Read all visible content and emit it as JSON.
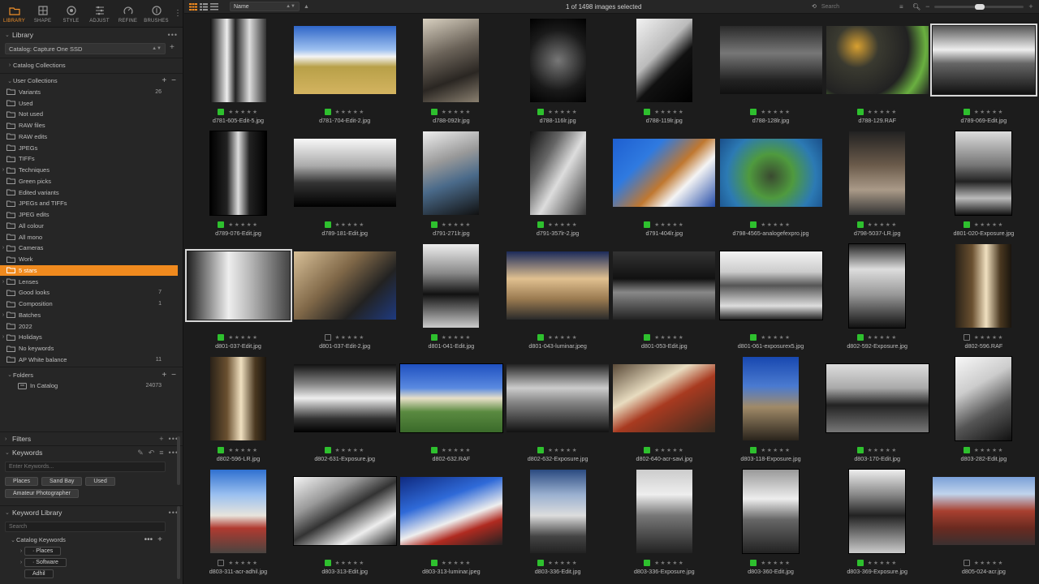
{
  "tool_tabs": [
    {
      "label": "LIBRARY",
      "icon": "library-icon",
      "active": true
    },
    {
      "label": "SHAPE",
      "icon": "shape-icon",
      "active": false
    },
    {
      "label": "STYLE",
      "icon": "style-icon",
      "active": false
    },
    {
      "label": "ADJUST",
      "icon": "adjust-icon",
      "active": false
    },
    {
      "label": "REFINE",
      "icon": "refine-icon",
      "active": false
    },
    {
      "label": "BRUSHES",
      "icon": "brushes-icon",
      "active": false
    }
  ],
  "library": {
    "title": "Library",
    "catalog": "Catalog: Capture One SSD",
    "catalog_collections": "Catalog Collections",
    "user_collections": "User Collections",
    "items": [
      {
        "label": "Variants",
        "count": "26",
        "expand": ""
      },
      {
        "label": "Used",
        "count": "",
        "expand": ""
      },
      {
        "label": "Not used",
        "count": "",
        "expand": ""
      },
      {
        "label": "RAW files",
        "count": "",
        "expand": ""
      },
      {
        "label": "RAW edits",
        "count": "",
        "expand": ""
      },
      {
        "label": "JPEGs",
        "count": "",
        "expand": ""
      },
      {
        "label": "TIFFs",
        "count": "",
        "expand": ""
      },
      {
        "label": "Techniques",
        "count": "",
        "expand": "›"
      },
      {
        "label": "Green picks",
        "count": "",
        "expand": ""
      },
      {
        "label": "Edited variants",
        "count": "",
        "expand": ""
      },
      {
        "label": "JPEGs and TIFFs",
        "count": "",
        "expand": ""
      },
      {
        "label": "JPEG edits",
        "count": "",
        "expand": ""
      },
      {
        "label": "All colour",
        "count": "",
        "expand": ""
      },
      {
        "label": "All mono",
        "count": "",
        "expand": ""
      },
      {
        "label": "Cameras",
        "count": "",
        "expand": "›"
      },
      {
        "label": "Work",
        "count": "",
        "expand": ""
      },
      {
        "label": "5 stars",
        "count": "",
        "expand": "",
        "selected": true
      },
      {
        "label": "Lenses",
        "count": "",
        "expand": "›"
      },
      {
        "label": "Good looks",
        "count": "7",
        "expand": ""
      },
      {
        "label": "Composition",
        "count": "1",
        "expand": ""
      },
      {
        "label": "Batches",
        "count": "",
        "expand": "›"
      },
      {
        "label": "2022",
        "count": "",
        "expand": ""
      },
      {
        "label": "Holidays",
        "count": "",
        "expand": "›"
      },
      {
        "label": "No keywords",
        "count": "",
        "expand": ""
      },
      {
        "label": "AP White balance",
        "count": "11",
        "expand": ""
      }
    ],
    "folders": "Folders",
    "in_catalog": "In Catalog",
    "in_catalog_count": "24073"
  },
  "filters": {
    "title": "Filters"
  },
  "keywords": {
    "title": "Keywords",
    "placeholder": "Enter Keywords...",
    "chips": [
      "Places",
      "Sand Bay",
      "Used",
      "Amateur Photographer"
    ]
  },
  "keyword_library": {
    "title": "Keyword Library",
    "search_placeholder": "Search",
    "catalog_keywords": "Catalog Keywords",
    "items": [
      "Places",
      "Software",
      "Adhil"
    ]
  },
  "topbar": {
    "sort": "Name",
    "selection": "1 of 1498 images selected",
    "search_placeholder": "Search"
  },
  "images": [
    {
      "name": "d781-605-Edit-5.jpg",
      "tag": "green",
      "orient": "p",
      "style": "mono-arch",
      "selected": false
    },
    {
      "name": "d781-704-Edit-2.jpg",
      "tag": "green",
      "orient": "l",
      "style": "field",
      "selected": false
    },
    {
      "name": "d788-092lr.jpg",
      "tag": "green",
      "orient": "p",
      "style": "sepia-cafe",
      "selected": false
    },
    {
      "name": "d788-116lr.jpg",
      "tag": "green",
      "orient": "p",
      "style": "bikes",
      "selected": false
    },
    {
      "name": "d788-119lr.jpg",
      "tag": "green",
      "orient": "p",
      "style": "lamp",
      "selected": false
    },
    {
      "name": "d788-128lr.jpg",
      "tag": "green",
      "orient": "l",
      "style": "house-dark",
      "selected": false
    },
    {
      "name": "d788-129.RAF",
      "tag": "green",
      "orient": "l",
      "style": "leaves",
      "selected": false
    },
    {
      "name": "d789-069-Edit.jpg",
      "tag": "green",
      "orient": "l",
      "style": "church",
      "selected": true
    },
    {
      "name": "d789-076-Edit.jpg",
      "tag": "green",
      "orient": "p",
      "style": "corridor",
      "selected": false,
      "frame": true
    },
    {
      "name": "d789-181-Edit.jpg",
      "tag": "green",
      "orient": "l",
      "style": "tor",
      "selected": false
    },
    {
      "name": "d791-271lr.jpg",
      "tag": "green",
      "orient": "p",
      "style": "modern",
      "selected": false
    },
    {
      "name": "d791-357lr-2.jpg",
      "tag": "green",
      "orient": "p",
      "style": "building-up",
      "selected": false
    },
    {
      "name": "d791-404lr.jpg",
      "tag": "green",
      "orient": "l",
      "style": "autumn",
      "selected": false
    },
    {
      "name": "d798-4565-analogefexpro.jpg",
      "tag": "green",
      "orient": "l",
      "style": "tree-up",
      "selected": false
    },
    {
      "name": "d798-5037-LR.jpg",
      "tag": "green",
      "orient": "p",
      "style": "towers",
      "selected": false
    },
    {
      "name": "d801-020-Exposure.jpg",
      "tag": "green",
      "orient": "p",
      "style": "sea",
      "selected": false,
      "frame": true
    },
    {
      "name": "d801-037-Edit.jpg",
      "tag": "green",
      "orient": "l",
      "style": "terrace-mono",
      "selected": true
    },
    {
      "name": "d801-037-Edit-2.jpg",
      "tag": "none",
      "orient": "l",
      "style": "terrace-warm",
      "selected": false
    },
    {
      "name": "d801-041-Edit.jpg",
      "tag": "green",
      "orient": "p",
      "style": "monolith",
      "selected": false
    },
    {
      "name": "d801-043-luminar.jpeg",
      "tag": "green",
      "orient": "l",
      "style": "terrace-blue",
      "selected": false
    },
    {
      "name": "d801-053-Edit.jpg",
      "tag": "green",
      "orient": "l",
      "style": "sunset-water",
      "selected": false
    },
    {
      "name": "d801-061-exposurex5.jpg",
      "tag": "green",
      "orient": "l",
      "style": "fountain",
      "selected": false,
      "frame": true
    },
    {
      "name": "d802-592-Exposure.jpg",
      "tag": "green",
      "orient": "p",
      "style": "bridge",
      "selected": false,
      "frame": true
    },
    {
      "name": "d802-596.RAF",
      "tag": "none",
      "orient": "p",
      "style": "window-warm",
      "selected": false
    },
    {
      "name": "d802-596-LR.jpg",
      "tag": "green",
      "orient": "p",
      "style": "window-warm",
      "selected": false
    },
    {
      "name": "d802-631-Exposure.jpg",
      "tag": "green",
      "orient": "l",
      "style": "crescent-mono",
      "selected": false
    },
    {
      "name": "d802-632.RAF",
      "tag": "green",
      "orient": "l",
      "style": "crescent-color",
      "selected": false,
      "frame": true
    },
    {
      "name": "d802-632-Exposure.jpg",
      "tag": "green",
      "orient": "l",
      "style": "crescent-mono2",
      "selected": false
    },
    {
      "name": "d802-640-acr-savi.jpg",
      "tag": "green",
      "orient": "l",
      "style": "sign",
      "selected": false
    },
    {
      "name": "d803-118-Exposure.jpg",
      "tag": "green",
      "orient": "p",
      "style": "tower-blue",
      "selected": false
    },
    {
      "name": "d803-170-Edit.jpg",
      "tag": "green",
      "orient": "l",
      "style": "ship",
      "selected": false,
      "frame": true
    },
    {
      "name": "d803-282-Edit.jpg",
      "tag": "green",
      "orient": "p",
      "style": "modern-white",
      "selected": false,
      "frame": true
    },
    {
      "name": "d803-311-acr-adhil.jpg",
      "tag": "none",
      "orient": "p",
      "style": "apartments",
      "selected": false
    },
    {
      "name": "d803-313-Edit.jpg",
      "tag": "green",
      "orient": "l",
      "style": "apart-mono",
      "selected": false,
      "frame": true
    },
    {
      "name": "d803-313-luminar.jpeg",
      "tag": "green",
      "orient": "l",
      "style": "apart-blue",
      "selected": false
    },
    {
      "name": "d803-336-Edit.jpg",
      "tag": "green",
      "orient": "p",
      "style": "apart-dusk",
      "selected": false
    },
    {
      "name": "d803-336-Exposure.jpg",
      "tag": "green",
      "orient": "p",
      "style": "apart-gray",
      "selected": false
    },
    {
      "name": "d803-360-Edit.jpg",
      "tag": "green",
      "orient": "p",
      "style": "cube",
      "selected": false,
      "frame": true
    },
    {
      "name": "d803-369-Exposure.jpg",
      "tag": "green",
      "orient": "p",
      "style": "sculpture",
      "selected": false,
      "frame": true
    },
    {
      "name": "d805-024-acr.jpg",
      "tag": "none",
      "orient": "l",
      "style": "redbrick",
      "selected": false
    }
  ],
  "colors": {
    "accent": "#f08a1e",
    "green_tag": "#2ec02e",
    "panel": "#262626",
    "grid_bg": "#1c1c1c"
  }
}
